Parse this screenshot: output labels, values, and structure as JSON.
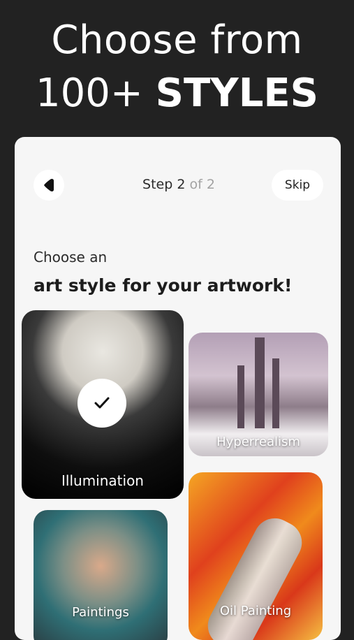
{
  "headline": {
    "line1": "Choose from",
    "line2_prefix": "100+",
    "line2_bold": "STYLES"
  },
  "header": {
    "back_icon": "back-arrow-icon",
    "step_label": "Step",
    "step_current": "2",
    "step_of": "of 2",
    "skip_label": "Skip"
  },
  "prompt": {
    "subtitle": "Choose an",
    "title": "art style for your artwork!"
  },
  "styles": [
    {
      "label": "Illumination",
      "selected": true
    },
    {
      "label": "Hyperrealism",
      "selected": false
    },
    {
      "label": "Paintings",
      "selected": false
    },
    {
      "label": "Oil Painting",
      "selected": false
    }
  ],
  "colors": {
    "background": "#222222",
    "card": "#f6f6f6",
    "accent_text": "#1d1d1d",
    "muted_text": "#a3a3a3"
  }
}
